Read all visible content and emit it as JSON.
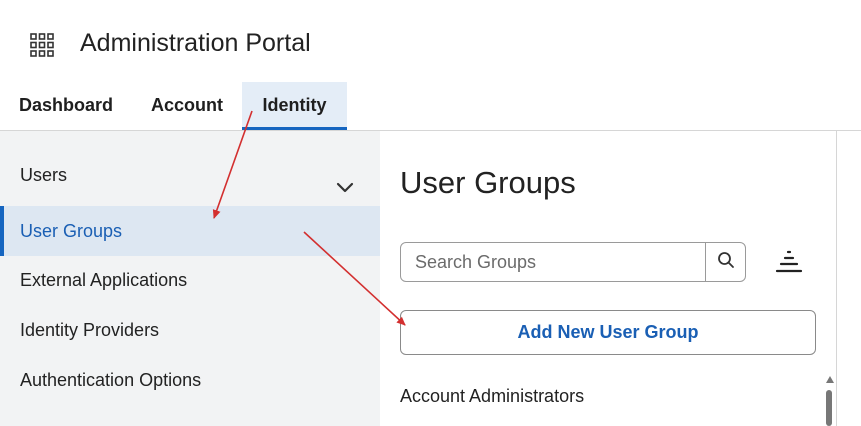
{
  "app": {
    "title": "Administration Portal",
    "grid_icon": "apps-grid-icon"
  },
  "tabs": [
    {
      "label": "Dashboard",
      "active": false
    },
    {
      "label": "Account",
      "active": false
    },
    {
      "label": "Identity",
      "active": true
    }
  ],
  "sidebar": {
    "items": [
      {
        "label": "Users",
        "expandable": true,
        "icon": "chevron-down-icon"
      },
      {
        "label": "User Groups",
        "selected": true
      },
      {
        "label": "External Applications"
      },
      {
        "label": "Identity Providers"
      },
      {
        "label": "Authentication Options"
      }
    ]
  },
  "main": {
    "title": "User Groups",
    "search": {
      "placeholder": "Search Groups",
      "value": "",
      "icon": "search-icon"
    },
    "sort_icon": "sort-icon",
    "add_button_label": "Add New User Group",
    "groups": [
      {
        "name": "Account Administrators"
      }
    ]
  },
  "colors": {
    "accent": "#1565c0",
    "selected_bg": "#dde7f2",
    "sidebar_bg": "#f2f3f4",
    "annotation_arrow": "#d32f2f"
  }
}
